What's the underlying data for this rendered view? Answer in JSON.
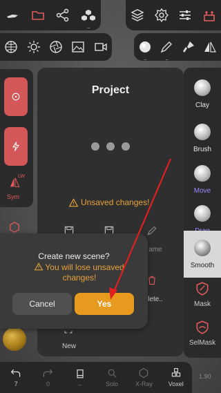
{
  "project_panel": {
    "title": "Project",
    "unsaved_text": "Unsaved changes!",
    "rename_label": "ame",
    "delete_label": "lete..",
    "new_label": "New"
  },
  "dialog": {
    "title": "Create new scene?",
    "warning": "You will lose unsaved changes!",
    "cancel_label": "Cancel",
    "yes_label": "Yes"
  },
  "left_panel": {
    "sym_label": "Sym",
    "lw_label": "LW"
  },
  "tools": [
    {
      "label": "Clay"
    },
    {
      "label": "Brush"
    },
    {
      "label": "Move"
    },
    {
      "label": "Drag"
    },
    {
      "label": "Smooth"
    },
    {
      "label": "Mask"
    },
    {
      "label": "SelMask"
    }
  ],
  "bottom_bar": {
    "undo_count": "7",
    "redo_count": "0",
    "solo_label": "Solo",
    "xray_label": "X-Ray",
    "voxel_label": "Voxel",
    "fps": "1.90"
  },
  "colors": {
    "accent": "#e69b1e",
    "warning": "#e8a23a",
    "red": "#d45858",
    "arrow": "#e02020"
  },
  "icons": {
    "top_left": [
      "hand-icon",
      "folder-icon",
      "share-icon",
      "cubes-icon"
    ],
    "top_right": [
      "layers-icon",
      "gear-icon",
      "sliders-icon",
      "tools-icon"
    ],
    "second_left": [
      "sphere-grid-icon",
      "sun-icon",
      "aperture-icon",
      "image-icon",
      "camera-icon"
    ],
    "second_right": [
      "brush-sphere-icon",
      "pen-icon",
      "paint-icon",
      "symmetry-icon"
    ]
  }
}
